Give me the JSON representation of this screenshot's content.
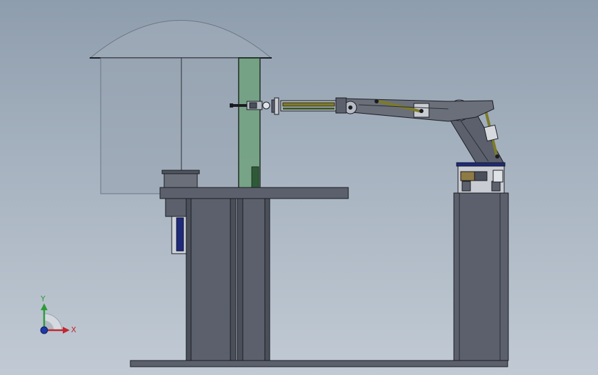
{
  "viewport": {
    "background_top": "#8e9dad",
    "background_bottom": "#c1cad4"
  },
  "triad": {
    "x_label": "X",
    "y_label": "Y",
    "x_color": "#c0282d",
    "y_color": "#2d9a3a",
    "z_color": "#1e3aa8"
  },
  "colors": {
    "steel": "#5b606c",
    "steel_dark": "#3b3f47",
    "outline": "#1a1c22",
    "tank_glass": "#a3adb9",
    "green_glass": "#6fa07c",
    "motor_blue": "#1f2a78",
    "cylinder_olive": "#7d7b2a",
    "brass": "#8e7a44"
  }
}
